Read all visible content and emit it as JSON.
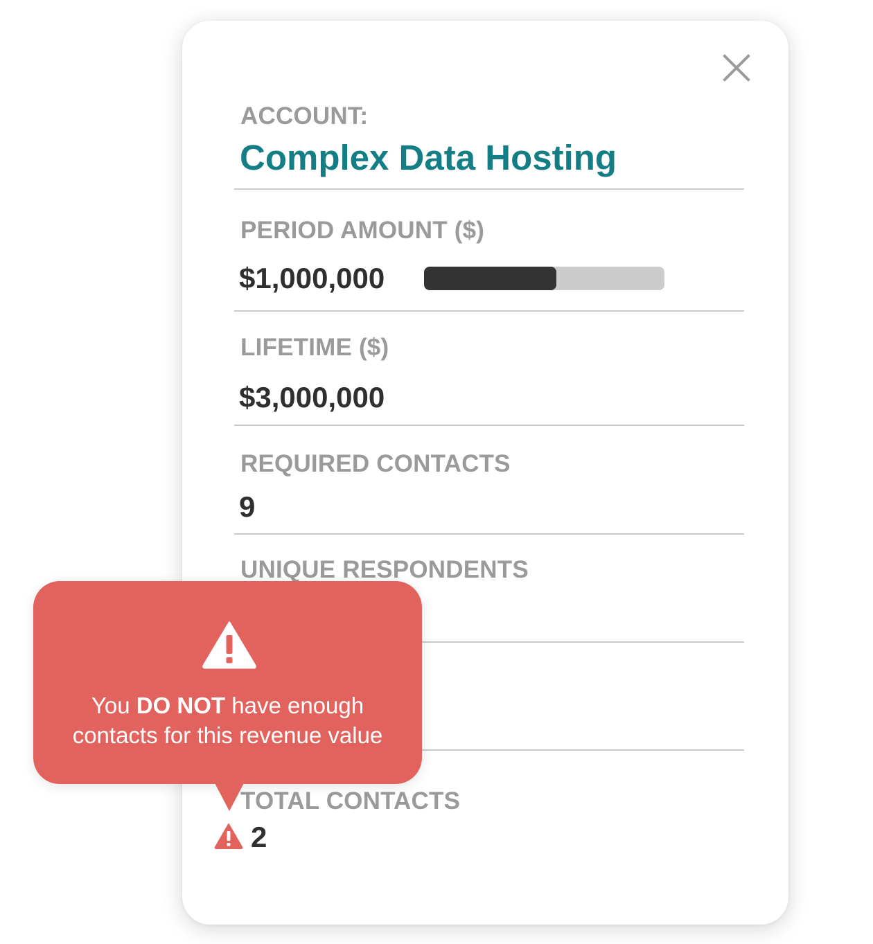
{
  "account": {
    "label": "ACCOUNT:",
    "name": "Complex Data Hosting"
  },
  "period_amount": {
    "label": "PERIOD AMOUNT ($)",
    "value": "$1,000,000",
    "progress_fraction": 0.55
  },
  "lifetime": {
    "label": "LIFETIME ($)",
    "value": "$3,000,000"
  },
  "required_contacts": {
    "label": "REQUIRED CONTACTS",
    "value": "9"
  },
  "unique_respondents": {
    "label": "UNIQUE RESPONDENTS"
  },
  "total_contacts": {
    "label": "TOTAL CONTACTS",
    "value": "2"
  },
  "warning_tooltip": {
    "text_before": "You ",
    "text_bold": "DO NOT",
    "text_after_line1": " have enough",
    "text_line2": "contacts for this revenue value"
  },
  "icons": {
    "close": "close-icon",
    "warning": "warning-triangle-icon"
  },
  "colors": {
    "accent": "#147e86",
    "label": "#9a9a9a",
    "value": "#2f2f2f",
    "warning": "#e2635d",
    "progress_fill": "#333333",
    "progress_track": "#cccccc"
  }
}
